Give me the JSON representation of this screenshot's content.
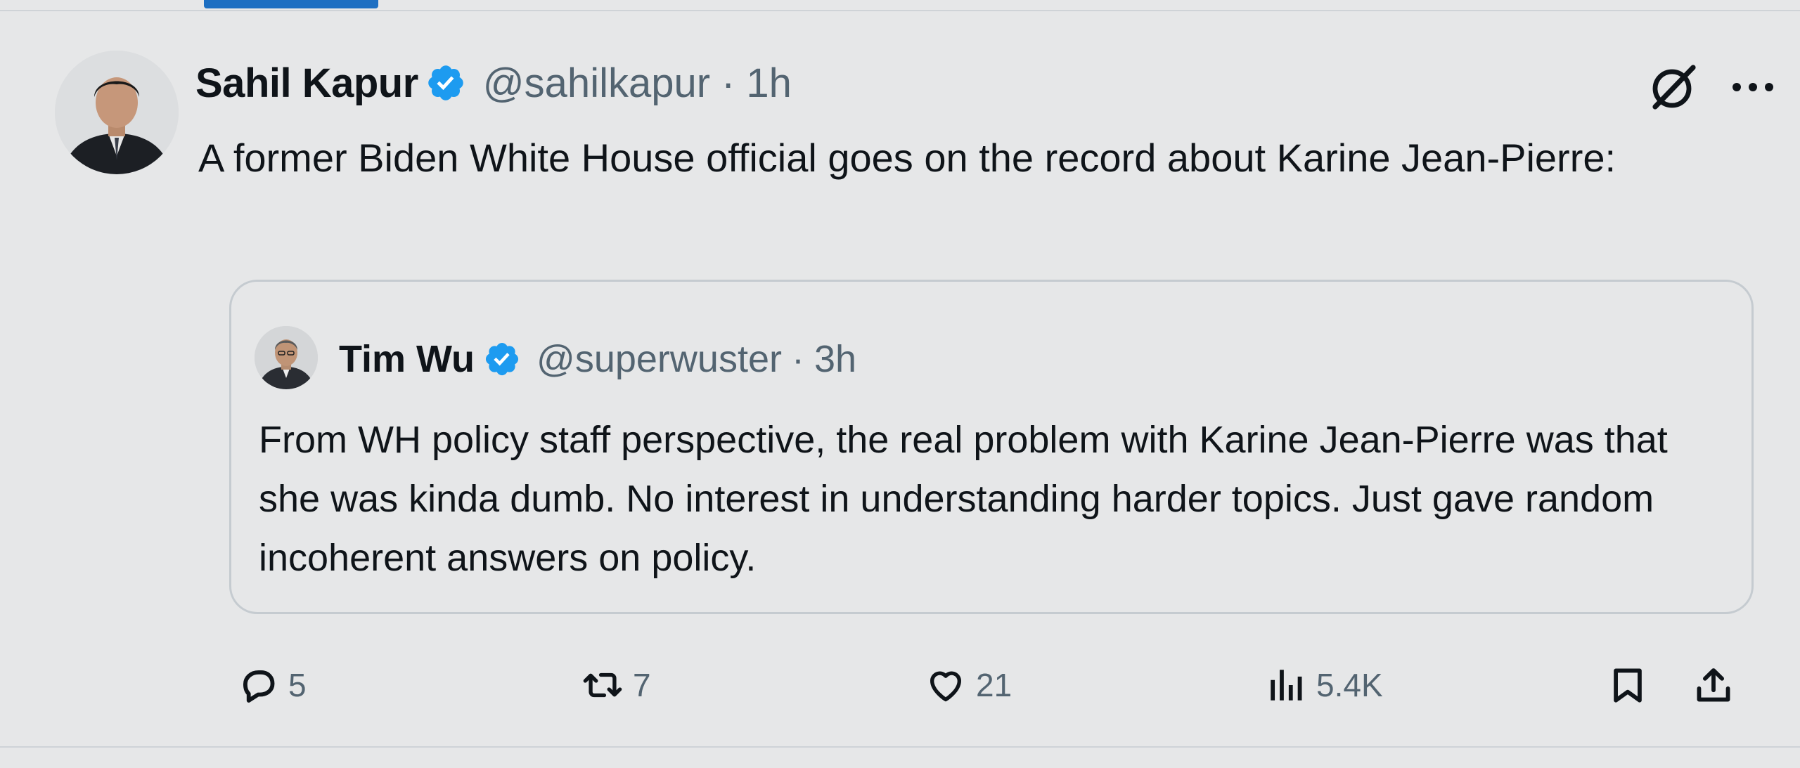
{
  "tweet": {
    "author": {
      "name": "Sahil Kapur",
      "handle": "@sahilkapur",
      "verified": true
    },
    "separator": "·",
    "time": "1h",
    "text": "A former Biden White House official goes on the record about Karine Jean-Pierre:",
    "header_icons": [
      "grok-icon",
      "more-icon"
    ]
  },
  "quote": {
    "author": {
      "name": "Tim Wu",
      "handle": "@superwuster",
      "verified": true
    },
    "separator": "·",
    "time": "3h",
    "text": "From WH policy staff perspective, the real problem with Karine Jean-Pierre was that she was kinda dumb.  No interest in understanding harder topics.  Just gave random incoherent answers on policy."
  },
  "actions": {
    "replies": "5",
    "retweets": "7",
    "likes": "21",
    "views": "5.4K",
    "icons": [
      "reply-icon",
      "retweet-icon",
      "like-icon",
      "views-icon",
      "bookmark-icon",
      "share-icon"
    ]
  },
  "colors": {
    "verified": "#1d9bf0",
    "muted_text": "#536471",
    "primary_text": "#0f1419",
    "accent": "#1d6fc2"
  }
}
